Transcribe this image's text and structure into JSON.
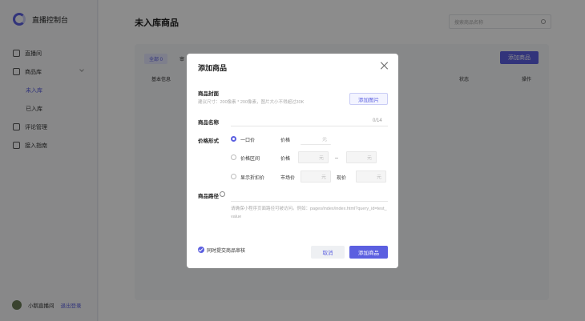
{
  "sidebar": {
    "brand_title": "直播控制台",
    "items": [
      {
        "label": "直播间"
      },
      {
        "label": "商品库",
        "sub": [
          "未入库",
          "已入库"
        ]
      },
      {
        "label": "评论管理"
      },
      {
        "label": "接入指南"
      }
    ],
    "user_name": "小鹅直播间",
    "logout_label": "退出登录"
  },
  "main": {
    "title": "未入库商品",
    "search_placeholder": "搜索商品名称",
    "tab_all": "全部 0",
    "tab_other": "审",
    "add_label": "添加商品",
    "columns": [
      "基本信息",
      "状态",
      "操作"
    ]
  },
  "modal": {
    "title": "添加商品",
    "cover_label": "商品封面",
    "cover_hint": "建议尺寸：200像素 * 200像素，图片大小不得超过30K",
    "add_image_label": "添加图片",
    "name_label": "商品名称",
    "name_counter": "0/14",
    "price_form_label": "价格形式",
    "options": [
      "一口价",
      "价格区间",
      "显示折扣价"
    ],
    "price_label": "价格",
    "market_price_label": "市场价",
    "current_price_label": "现价",
    "unit": "元",
    "path_label": "商品路径",
    "path_placeholder": "请确保小程序页面路径可被访问。例如：pages/index/index.html?query_id=test_value",
    "audit_label": "同时提交商品审核",
    "cancel_label": "取消",
    "submit_label": "添加商品",
    "accent": "#5b5fe0"
  }
}
